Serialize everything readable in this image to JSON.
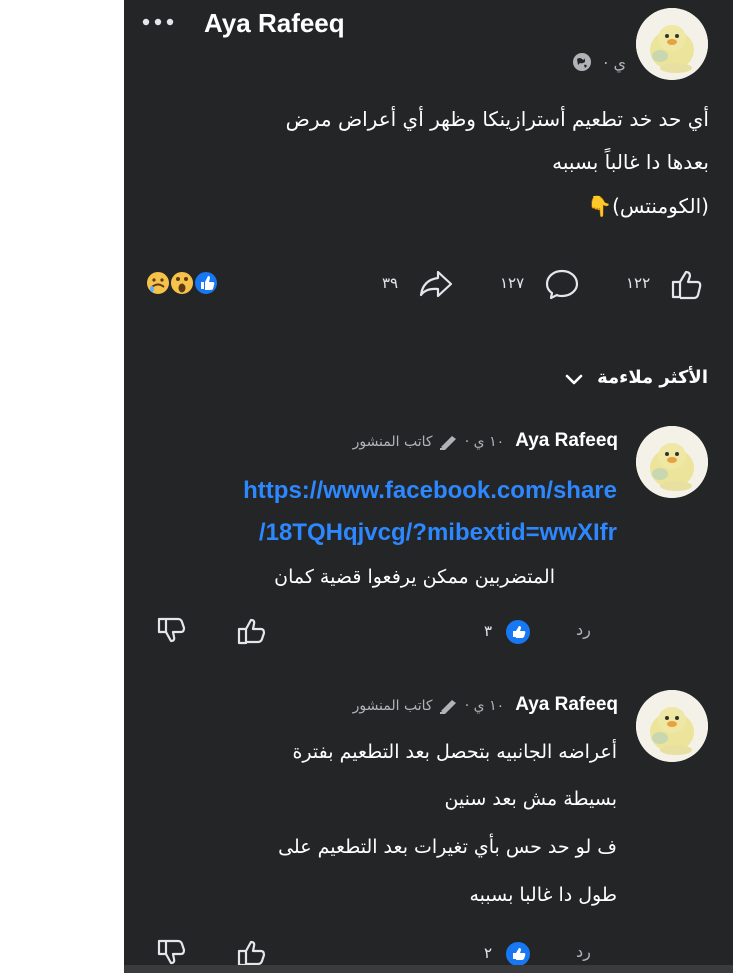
{
  "post": {
    "author": "Aya Rafeeq",
    "time": "ي ·",
    "text_lines": [
      "أي حد خد تطعيم أسترازينكا وظهر أي أعراض مرض",
      "بعدها دا غالباً بسببه",
      "(الكومنتس)👇"
    ],
    "likes_count": "١٢٢",
    "comments_count": "١٢٧",
    "shares_count": "٣٩"
  },
  "sort": {
    "label": "الأكثر ملاءمة"
  },
  "comments": [
    {
      "author": "Aya Rafeeq",
      "meta_time": "١٠ ي ·",
      "author_badge": "كاتب المنشور",
      "link_lines": [
        "https://www.facebook.com/share",
        "/18TQHqjvcg/?mibextid=wwXIfr"
      ],
      "text_lines": [
        "المتضربين ممكن يرفعوا قضية كمان"
      ],
      "reply_label": "رد",
      "reaction_count": "٣"
    },
    {
      "author": "Aya Rafeeq",
      "meta_time": "١٠ ي ·",
      "author_badge": "كاتب المنشور",
      "text_lines": [
        "أعراضه الجانبيه بتحصل بعد التطعيم بفترة",
        "بسيطة مش بعد سنين",
        "ف لو حد حس بأي تغيرات بعد التطعيم على",
        "طول دا غالبا بسببه"
      ],
      "reply_label": "رد",
      "reaction_count": "٢"
    }
  ],
  "colors": {
    "background": "#242526",
    "text": "#ffffff",
    "secondary": "#b0b3b8",
    "link": "#2d88ff",
    "like_blue": "#1877f2"
  }
}
